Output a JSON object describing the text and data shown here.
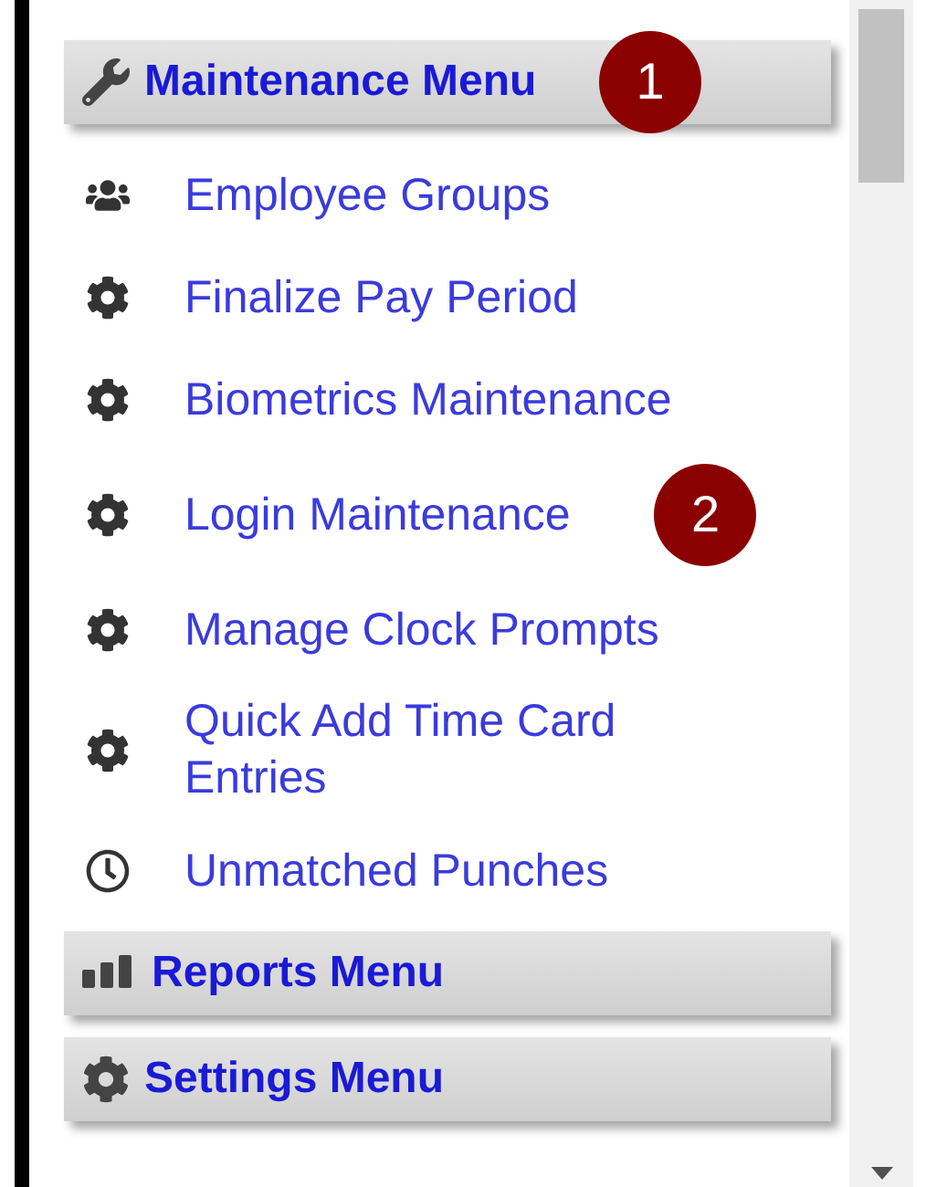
{
  "menus": [
    {
      "label": "Maintenance Menu",
      "kind": "wrench",
      "badge": "1",
      "items": [
        {
          "label": "Employee Groups",
          "kind": "people"
        },
        {
          "label": "Finalize Pay Period",
          "kind": "gear"
        },
        {
          "label": "Biometrics Maintenance",
          "kind": "gear"
        },
        {
          "label": "Login Maintenance",
          "kind": "gear",
          "badge": "2"
        },
        {
          "label": "Manage Clock Prompts",
          "kind": "gear"
        },
        {
          "label": "Quick Add Time Card Entries",
          "kind": "gear"
        },
        {
          "label": "Unmatched Punches",
          "kind": "clock"
        }
      ]
    },
    {
      "label": "Reports Menu",
      "kind": "bars"
    },
    {
      "label": "Settings Menu",
      "kind": "gear"
    }
  ]
}
